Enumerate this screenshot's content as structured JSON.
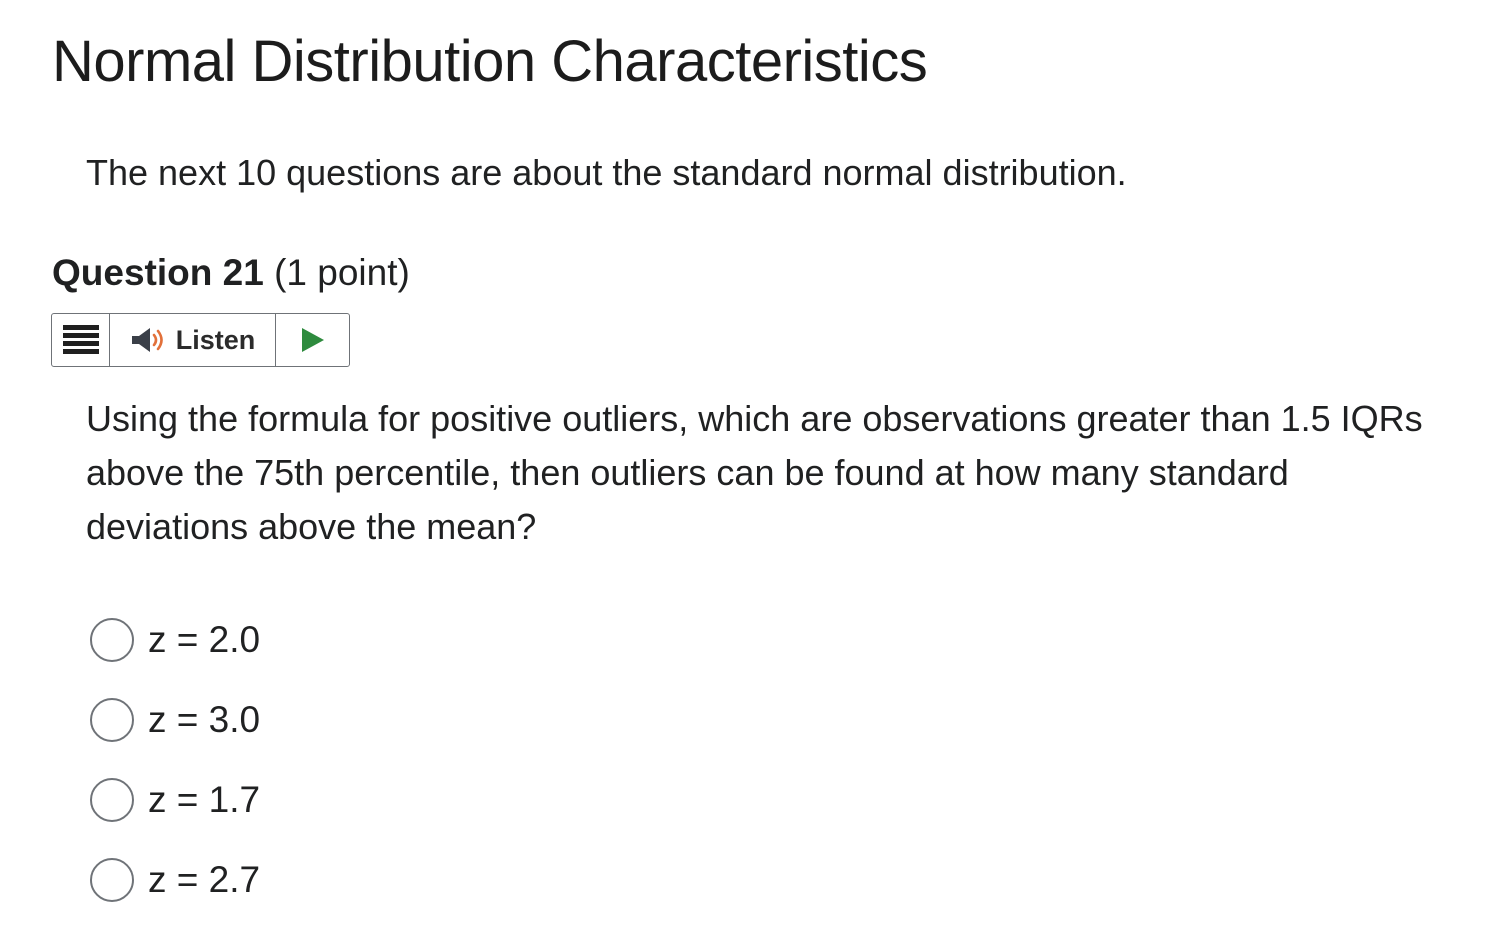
{
  "page": {
    "title": "Normal Distribution Characteristics",
    "intro": "The next 10 questions are about the standard normal distribution."
  },
  "question": {
    "number_label": "Question 21",
    "points_label": "(1 point)",
    "prompt_lines": [
      "Using the formula for positive outliers, which are observations greater than 1.5 IQRs",
      "above the 75th percentile, then outliers can be found at how many standard",
      "deviations above the mean?"
    ],
    "options": [
      {
        "label": "z = 2.0",
        "selected": false
      },
      {
        "label": "z = 3.0",
        "selected": false
      },
      {
        "label": "z = 1.7",
        "selected": false
      },
      {
        "label": "z = 2.7",
        "selected": false
      }
    ]
  },
  "listen_toolbar": {
    "menu_icon": "menu-icon",
    "speaker_icon": "speaker-icon",
    "listen_label": "Listen",
    "play_icon": "play-icon",
    "colors": {
      "speaker": "#3a3f48",
      "sound_waves": "#e2703a",
      "play": "#2e8b3e"
    }
  }
}
